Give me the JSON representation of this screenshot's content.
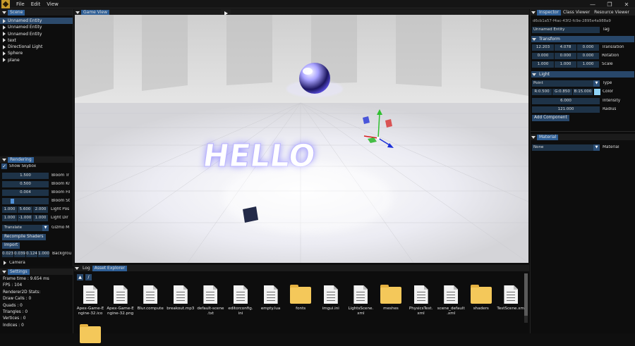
{
  "menubar": {
    "items": [
      "File",
      "Edit",
      "View"
    ]
  },
  "window_controls": [
    "—",
    "❐",
    "✕"
  ],
  "scene_panel": {
    "tab": "Scene",
    "items": [
      "Unnamed Entity",
      "Unnamed Entity",
      "Unnamed Entity",
      "text",
      "Directional Light",
      "Sphere",
      "plane"
    ]
  },
  "rendering_panel": {
    "tab": "Rendering",
    "show_skybox_label": "Show Skybox",
    "show_skybox": true,
    "bloom_threshold": {
      "value": "1.500",
      "label": "Bloom Tr"
    },
    "bloom_knee": {
      "value": "0.500",
      "label": "Bloom Kr"
    },
    "bloom_filter": {
      "value": "0.004",
      "label": "Bloom Fil"
    },
    "bloom_strength": {
      "label": "Bloom St",
      "level": 0.2
    },
    "light_pos": {
      "values": [
        "1.000",
        "5.600",
        "2.000"
      ],
      "label": "Light Pos"
    },
    "light_dir": {
      "values": [
        "1.000",
        "-1.000",
        "1.000"
      ],
      "label": "Light Dir"
    },
    "gizmo_mode": {
      "value": "Translate",
      "label": "Gizmo M"
    },
    "recompile_label": "Recompile Shaders",
    "import_label": "Import",
    "background": {
      "values": [
        "0.023",
        "0.039",
        "0.124",
        "1.000"
      ],
      "label": "Backgrou"
    },
    "camera_label": "Camera"
  },
  "settings_panel": {
    "tab": "Settings",
    "stats": [
      "Frame time : 9.654 ms",
      "FPS : 104",
      "Renderer2D Stats:",
      "Draw Calls : 0",
      "Quads : 0",
      "Triangles : 0",
      "Vertices : 0",
      "Indices : 0"
    ]
  },
  "game_view": {
    "tab": "Game View",
    "play_icon": "play-icon",
    "text3d": "HELLO"
  },
  "bottom_panel": {
    "tabs": [
      "Log",
      "Asset Explorer"
    ],
    "path": "/",
    "files": [
      {
        "name": "Apex-Game-Engine-32.ico",
        "lines": [
          "Apex-Game-E",
          "ngine-32.ico"
        ],
        "type": "file"
      },
      {
        "name": "Apex-Game-Engine-32.png",
        "lines": [
          "Apex-Game-E",
          "ngine-32.png"
        ],
        "type": "file"
      },
      {
        "name": "Blur.compute",
        "lines": [
          "Blur.compute"
        ],
        "type": "file"
      },
      {
        "name": "breakout.mp3",
        "lines": [
          "breakout.mp3"
        ],
        "type": "file"
      },
      {
        "name": "default-scene.txt",
        "lines": [
          "default-scene",
          ".txt"
        ],
        "type": "file"
      },
      {
        "name": "editorconfig.ini",
        "lines": [
          "editorconfig.",
          "ini"
        ],
        "type": "file"
      },
      {
        "name": "empty.lua",
        "lines": [
          "empty.lua"
        ],
        "type": "file"
      },
      {
        "name": "fonts",
        "lines": [
          "fonts"
        ],
        "type": "folder"
      },
      {
        "name": "imgui.ini",
        "lines": [
          "imgui.ini"
        ],
        "type": "file"
      },
      {
        "name": "LightsScene.xml",
        "lines": [
          "LightsScene.",
          "xml"
        ],
        "type": "file"
      },
      {
        "name": "meshes",
        "lines": [
          "meshes"
        ],
        "type": "folder"
      },
      {
        "name": "PhysicsTest.xml",
        "lines": [
          "PhysicsTest.",
          "xml"
        ],
        "type": "file"
      },
      {
        "name": "scene_default.xml",
        "lines": [
          "scene_default",
          ".xml"
        ],
        "type": "file"
      },
      {
        "name": "shaders",
        "lines": [
          "shaders"
        ],
        "type": "folder"
      },
      {
        "name": "TestScene.xml",
        "lines": [
          "TestScene.xml"
        ],
        "type": "file"
      }
    ]
  },
  "inspector": {
    "tabs": [
      "Inspector",
      "Class Viewer",
      "Resource Viewer"
    ],
    "uuid": "d6cb1a57-f4ac-43f2-fc9e-2895e4a988a9",
    "name": "Unnamed Entity",
    "tag_label": "Tag",
    "transform": {
      "header": "Transform",
      "translation": {
        "values": [
          "12.203",
          "4.078",
          "0.000"
        ],
        "label": "Translation"
      },
      "rotation": {
        "values": [
          "0.000",
          "0.000",
          "0.000"
        ],
        "label": "Rotation"
      },
      "scale": {
        "values": [
          "1.000",
          "1.000",
          "1.000"
        ],
        "label": "Scale"
      }
    },
    "light": {
      "header": "Light",
      "type_value": "Point",
      "type_label": "Type",
      "color_values": [
        "R:0.500",
        "G:0.850",
        "B:15.000"
      ],
      "color_label": "Color",
      "swatch": "#8fd3f7",
      "intensity": {
        "value": "6.000",
        "label": "Intensity"
      },
      "radius": {
        "value": "121.000",
        "label": "Radius"
      }
    },
    "add_component": "Add Component",
    "material": {
      "header": "Material",
      "value": "None",
      "label": "Material"
    }
  },
  "colors": {
    "accent": "#2f5f96",
    "field": "#1e3348",
    "background": "#0d0d0d"
  }
}
